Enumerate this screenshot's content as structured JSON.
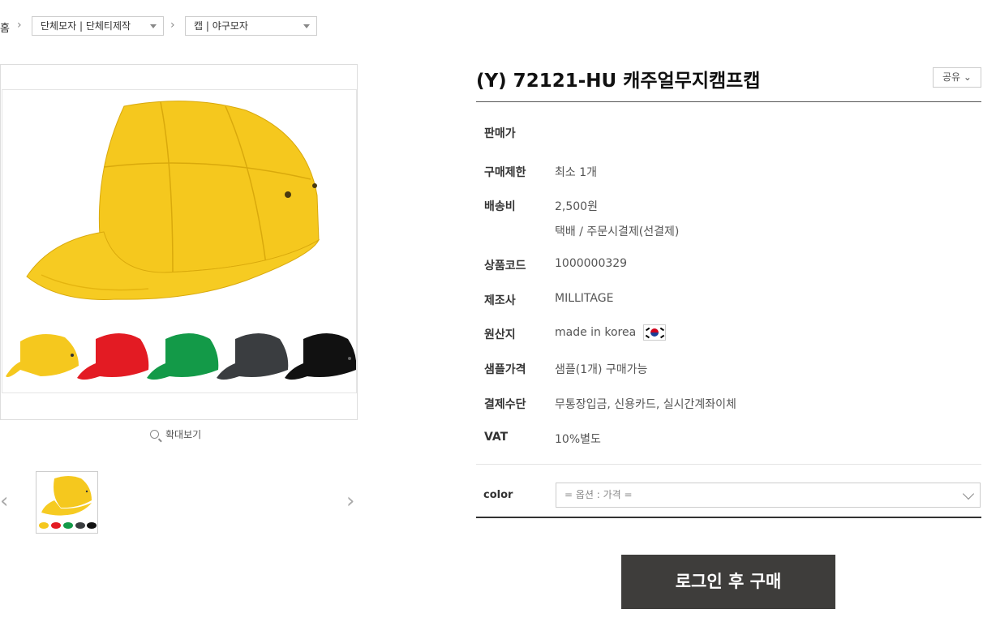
{
  "breadcrumb": {
    "home": "홈",
    "category1": "단체모자 | 단체티제작",
    "category2": "캡 | 야구모자"
  },
  "gallery": {
    "zoom_label": "확대보기",
    "color_swatches": [
      "#f5c81e",
      "#e31b23",
      "#139a48",
      "#3a3d40",
      "#111111"
    ]
  },
  "product": {
    "title": "(Y) 72121-HU 캐주얼무지캠프캡",
    "share_label": "공유 ⌄",
    "info": [
      {
        "label": "판매가",
        "value": ""
      },
      {
        "label": "구매제한",
        "value": "최소 1개"
      },
      {
        "label": "배송비",
        "value": "2,500원",
        "sub": "택배   /   주문시결제(선결제)"
      },
      {
        "label": "상품코드",
        "value": "1000000329"
      },
      {
        "label": "제조사",
        "value": "MILLITAGE"
      },
      {
        "label": "원산지",
        "value": "made in korea"
      },
      {
        "label": "샘플가격",
        "value": "샘플(1개) 구매가능"
      },
      {
        "label": "결제수단",
        "value": "무통장입금, 신용카드, 실시간계좌이체"
      },
      {
        "label": "VAT",
        "value": "10%별도"
      }
    ]
  },
  "option": {
    "label": "color",
    "placeholder": "= 옵션 : 가격 ="
  },
  "buy_button": "로그인 후 구매"
}
